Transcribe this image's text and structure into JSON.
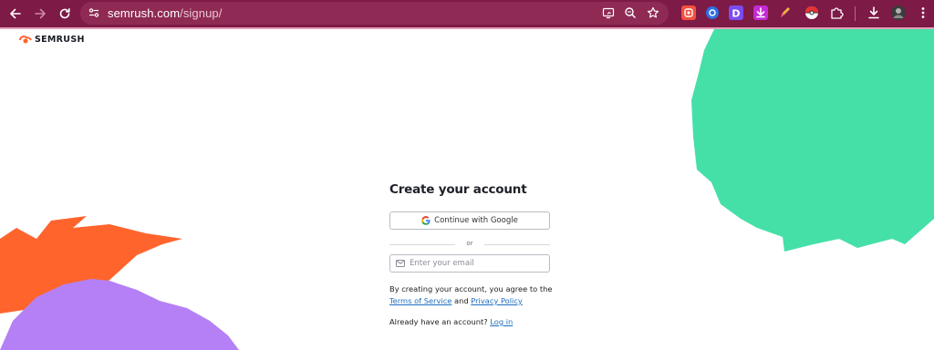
{
  "browser": {
    "url_host": "semrush.com",
    "url_path": "/signup/",
    "colors": {
      "toolbar": "#7d1a45",
      "omnibox": "#8f2a55"
    },
    "nav_icons": [
      "back-arrow-icon",
      "forward-arrow-icon",
      "reload-icon"
    ],
    "omnibox_icons": [
      "site-settings-icon",
      "cast-icon",
      "zoom-icon",
      "bookmark-star-icon"
    ],
    "extensions": [
      "extension-orange-icon",
      "extension-blue-circle-icon",
      "extension-d-icon",
      "extension-download-icon",
      "extension-pencil-icon",
      "extension-pokeball-icon",
      "extensions-puzzle-icon"
    ],
    "right_icons": [
      "download-icon",
      "profile-avatar-icon",
      "menu-kebab-icon"
    ]
  },
  "page": {
    "logo_text": "SEMRUSH",
    "title": "Create your account",
    "google_button": "Continue with Google",
    "divider_text": "or",
    "email_placeholder": "Enter your email",
    "terms_prefix": "By creating your account, you agree to the",
    "terms_link": "Terms of Service",
    "terms_and": "and",
    "privacy_link": "Privacy Policy",
    "login_prompt": "Already have an account?",
    "login_link": "Log in"
  },
  "colors": {
    "brand_orange": "#ff642d",
    "green": "#45e0a8",
    "purple": "#b580f5",
    "link": "#1e6ec2"
  }
}
